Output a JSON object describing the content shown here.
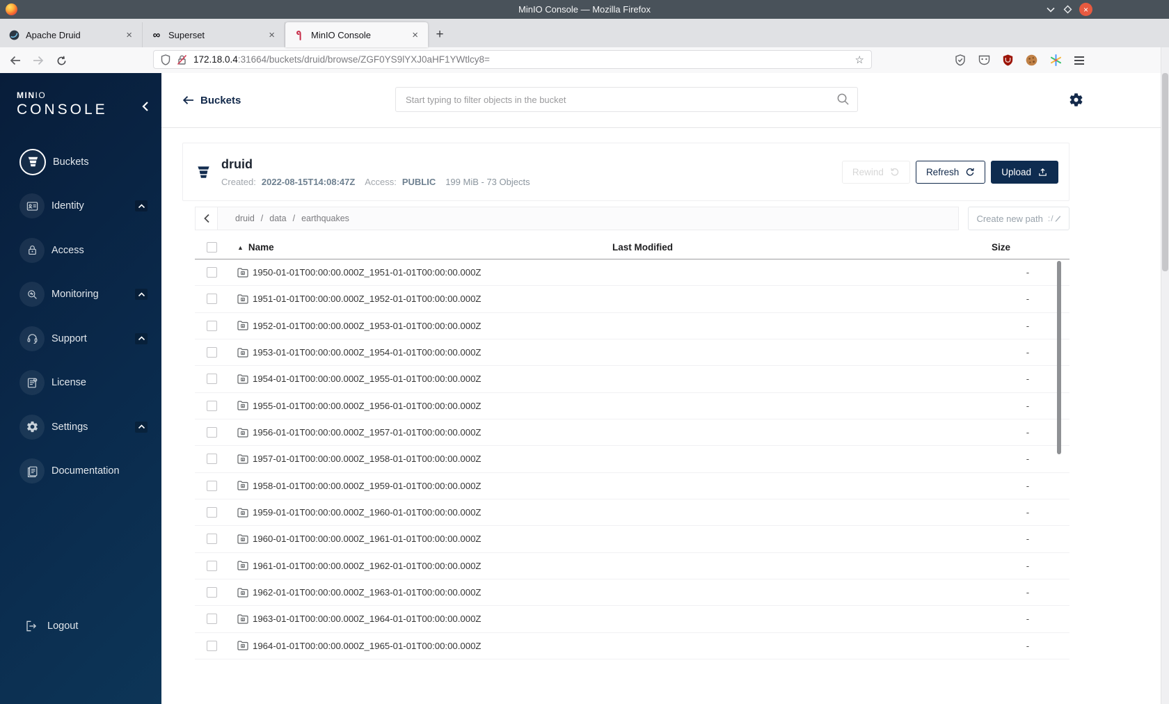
{
  "window": {
    "title": "MinIO Console — Mozilla Firefox"
  },
  "browser_chrome": {
    "tabs": [
      {
        "label": "Apache Druid"
      },
      {
        "label": "Superset"
      },
      {
        "label": "MinIO Console"
      }
    ],
    "new_tab": "+",
    "url_host": "172.18.0.4",
    "url_rest": ":31664/buckets/druid/browse/ZGF0YS9lYXJ0aHF1YWtlcy8="
  },
  "sidebar": {
    "logo_primary": "MIN",
    "logo_secondary": "IO",
    "logo_sub": "CONSOLE",
    "items": [
      {
        "label": "Buckets"
      },
      {
        "label": "Identity"
      },
      {
        "label": "Access"
      },
      {
        "label": "Monitoring"
      },
      {
        "label": "Support"
      },
      {
        "label": "License"
      },
      {
        "label": "Settings"
      },
      {
        "label": "Documentation"
      }
    ],
    "logout_label": "Logout"
  },
  "header": {
    "back_label": "Buckets",
    "search_placeholder": "Start typing to filter objects in the bucket"
  },
  "bucket": {
    "name": "druid",
    "created_label": "Created:",
    "created_value": "2022-08-15T14:08:47Z",
    "access_label": "Access:",
    "access_value": "PUBLIC",
    "summary": "199 MiB - 73 Objects",
    "rewind_label": "Rewind",
    "refresh_label": "Refresh",
    "upload_label": "Upload"
  },
  "object_browser": {
    "breadcrumb": [
      "druid",
      "data",
      "earthquakes"
    ],
    "separator": "/",
    "create_path_label": "Create new path",
    "columns": {
      "name": "Name",
      "modified": "Last Modified",
      "size": "Size"
    },
    "rows": [
      {
        "name": "1950-01-01T00:00:00.000Z_1951-01-01T00:00:00.000Z",
        "size": "-"
      },
      {
        "name": "1951-01-01T00:00:00.000Z_1952-01-01T00:00:00.000Z",
        "size": "-"
      },
      {
        "name": "1952-01-01T00:00:00.000Z_1953-01-01T00:00:00.000Z",
        "size": "-"
      },
      {
        "name": "1953-01-01T00:00:00.000Z_1954-01-01T00:00:00.000Z",
        "size": "-"
      },
      {
        "name": "1954-01-01T00:00:00.000Z_1955-01-01T00:00:00.000Z",
        "size": "-"
      },
      {
        "name": "1955-01-01T00:00:00.000Z_1956-01-01T00:00:00.000Z",
        "size": "-"
      },
      {
        "name": "1956-01-01T00:00:00.000Z_1957-01-01T00:00:00.000Z",
        "size": "-"
      },
      {
        "name": "1957-01-01T00:00:00.000Z_1958-01-01T00:00:00.000Z",
        "size": "-"
      },
      {
        "name": "1958-01-01T00:00:00.000Z_1959-01-01T00:00:00.000Z",
        "size": "-"
      },
      {
        "name": "1959-01-01T00:00:00.000Z_1960-01-01T00:00:00.000Z",
        "size": "-"
      },
      {
        "name": "1960-01-01T00:00:00.000Z_1961-01-01T00:00:00.000Z",
        "size": "-"
      },
      {
        "name": "1961-01-01T00:00:00.000Z_1962-01-01T00:00:00.000Z",
        "size": "-"
      },
      {
        "name": "1962-01-01T00:00:00.000Z_1963-01-01T00:00:00.000Z",
        "size": "-"
      },
      {
        "name": "1963-01-01T00:00:00.000Z_1964-01-01T00:00:00.000Z",
        "size": "-"
      },
      {
        "name": "1964-01-01T00:00:00.000Z_1965-01-01T00:00:00.000Z",
        "size": "-"
      }
    ]
  }
}
